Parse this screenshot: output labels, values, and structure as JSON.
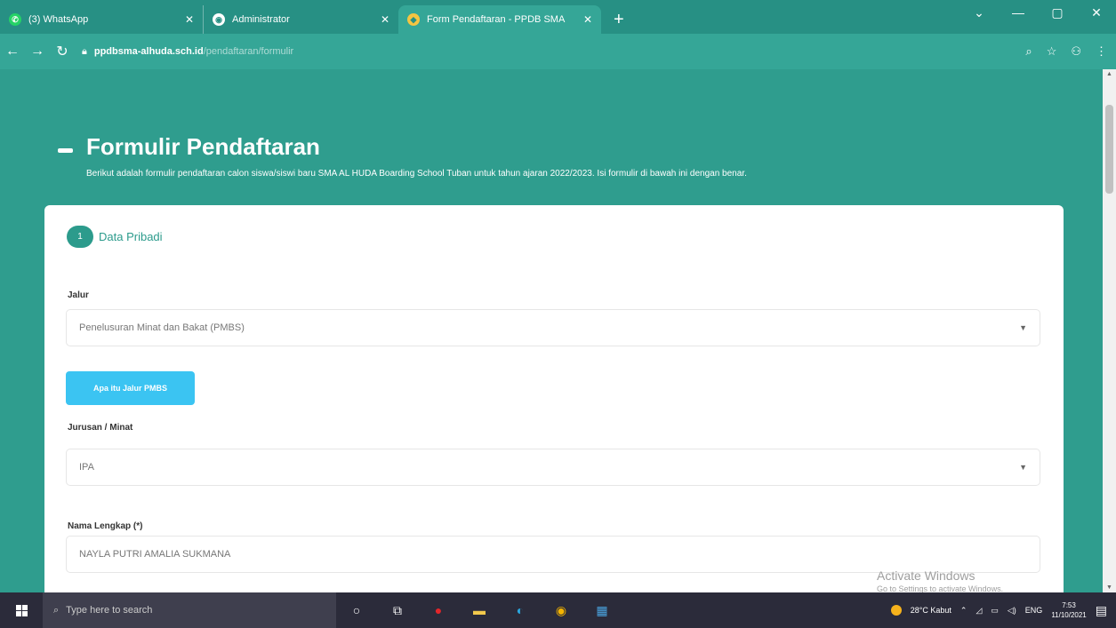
{
  "browser": {
    "tabs": [
      {
        "label": "(3) WhatsApp",
        "icon": "whatsapp-icon",
        "color": "#25d366"
      },
      {
        "label": "Administrator",
        "icon": "chrome-icon",
        "color": "#ffffff"
      },
      {
        "label": "Form Pendaftaran - PPDB SMA",
        "icon": "site-icon",
        "color": "#f4c542"
      }
    ],
    "new_tab": "+",
    "url_host": "ppdbsma-alhuda.sch.id",
    "url_path": "/pendaftaran/formulir",
    "window_controls": [
      "⌄",
      "—",
      "▢",
      "✕"
    ]
  },
  "page": {
    "title": "Formulir Pendaftaran",
    "subtitle": "Berikut adalah formulir pendaftaran calon siswa/siswi baru SMA AL HUDA Boarding School Tuban untuk tahun ajaran 2022/2023. Isi formulir di bawah ini dengan benar.",
    "step": {
      "number": "1",
      "label": "Data Pribadi"
    },
    "fields": {
      "jalur": {
        "label": "Jalur",
        "value": "Penelusuran Minat dan Bakat (PMBS)"
      },
      "info_button": "Apa itu Jalur PMBS",
      "jurusan": {
        "label": "Jurusan / Minat",
        "value": "IPA"
      },
      "nama": {
        "label": "Nama Lengkap (*)",
        "value": "NAYLA PUTRI AMALIA SUKMANA"
      }
    }
  },
  "watermark": {
    "line1": "Activate Windows",
    "line2": "Go to Settings to activate Windows."
  },
  "taskbar": {
    "search_placeholder": "Type here to search",
    "weather": "28°C Kabut",
    "lang": "ENG",
    "time": "7:53",
    "date": "11/10/2021"
  },
  "colors": {
    "teal_bg": "#2f9d8e",
    "accent_teal": "#2c9b8c",
    "info_button": "#3bc4f2"
  }
}
